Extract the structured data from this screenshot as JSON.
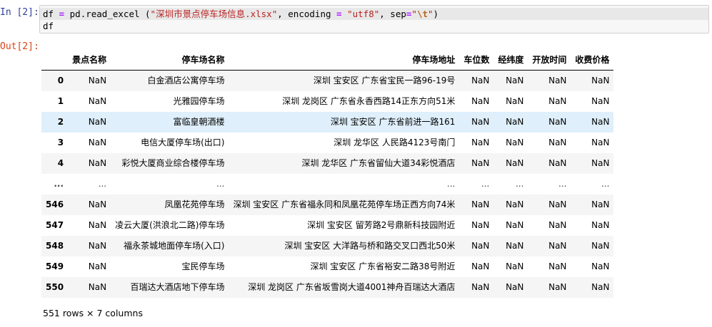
{
  "input_cell": {
    "prompt": "In [2]:",
    "code": {
      "line1": {
        "var": "df",
        "eq": "=",
        "call": "pd.read_excel (",
        "filename": "\"深圳市景点停车场信息.xlsx\"",
        "comma1": ", encoding",
        "eq2": "=",
        "encoding": "\"utf8\"",
        "comma2": ", sep",
        "eq3": "=",
        "sep_open": "\"",
        "sep_esc": "\\t",
        "sep_close": "\"",
        "paren_close": ")"
      },
      "line2": "df"
    }
  },
  "output_cell": {
    "prompt": "Out[2]:",
    "table": {
      "columns": [
        "景点名称",
        "停车场名称",
        "停车场地址",
        "车位数",
        "经纬度",
        "开放时间",
        "收费价格"
      ],
      "rows": [
        {
          "index": "0",
          "cells": [
            "NaN",
            "白金酒店公寓停车场",
            "深圳 宝安区 广东省宝民一路96-19号",
            "NaN",
            "NaN",
            "NaN",
            "NaN"
          ]
        },
        {
          "index": "1",
          "cells": [
            "NaN",
            "光雅园停车场",
            "深圳 龙岗区 广东省永香西路14正东方向51米",
            "NaN",
            "NaN",
            "NaN",
            "NaN"
          ]
        },
        {
          "index": "2",
          "cells": [
            "NaN",
            "富临皇朝酒楼",
            "深圳 宝安区 广东省前进一路161",
            "NaN",
            "NaN",
            "NaN",
            "NaN"
          ]
        },
        {
          "index": "3",
          "cells": [
            "NaN",
            "电信大厦停车场(出口)",
            "深圳 龙华区 人民路4123号南门",
            "NaN",
            "NaN",
            "NaN",
            "NaN"
          ]
        },
        {
          "index": "4",
          "cells": [
            "NaN",
            "彩悦大厦商业综合楼停车场",
            "深圳 龙华区 广东省留仙大道34彩悦酒店",
            "NaN",
            "NaN",
            "NaN",
            "NaN"
          ]
        },
        {
          "index": "...",
          "cells": [
            "...",
            "...",
            "...",
            "...",
            "...",
            "...",
            "..."
          ]
        },
        {
          "index": "546",
          "cells": [
            "NaN",
            "凤凰花苑停车场",
            "深圳 宝安区 广东省福永同和凤凰花苑停车场正西方向74米",
            "NaN",
            "NaN",
            "NaN",
            "NaN"
          ]
        },
        {
          "index": "547",
          "cells": [
            "NaN",
            "凌云大厦(洪浪北二路)停车场",
            "深圳 宝安区 留芳路2号鼎新科技园附近",
            "NaN",
            "NaN",
            "NaN",
            "NaN"
          ]
        },
        {
          "index": "548",
          "cells": [
            "NaN",
            "福永茶城地面停车场(入口)",
            "深圳 宝安区 大洋路与桥和路交叉口西北50米",
            "NaN",
            "NaN",
            "NaN",
            "NaN"
          ]
        },
        {
          "index": "549",
          "cells": [
            "NaN",
            "宝民停车场",
            "深圳 宝安区 广东省裕安二路38号附近",
            "NaN",
            "NaN",
            "NaN",
            "NaN"
          ]
        },
        {
          "index": "550",
          "cells": [
            "NaN",
            "百瑞达大酒店地下停车场",
            "深圳 龙岗区 广东省坂雪岗大道4001神舟百瑞达大酒店",
            "NaN",
            "NaN",
            "NaN",
            "NaN"
          ]
        }
      ],
      "hovered_row_index": 2
    },
    "summary": "551 rows × 7 columns"
  },
  "colors": {
    "prompt_in": "#303f9f",
    "prompt_out": "#d84315",
    "code_bg": "#f7f7f7",
    "row_hover": "#dfeffb"
  }
}
